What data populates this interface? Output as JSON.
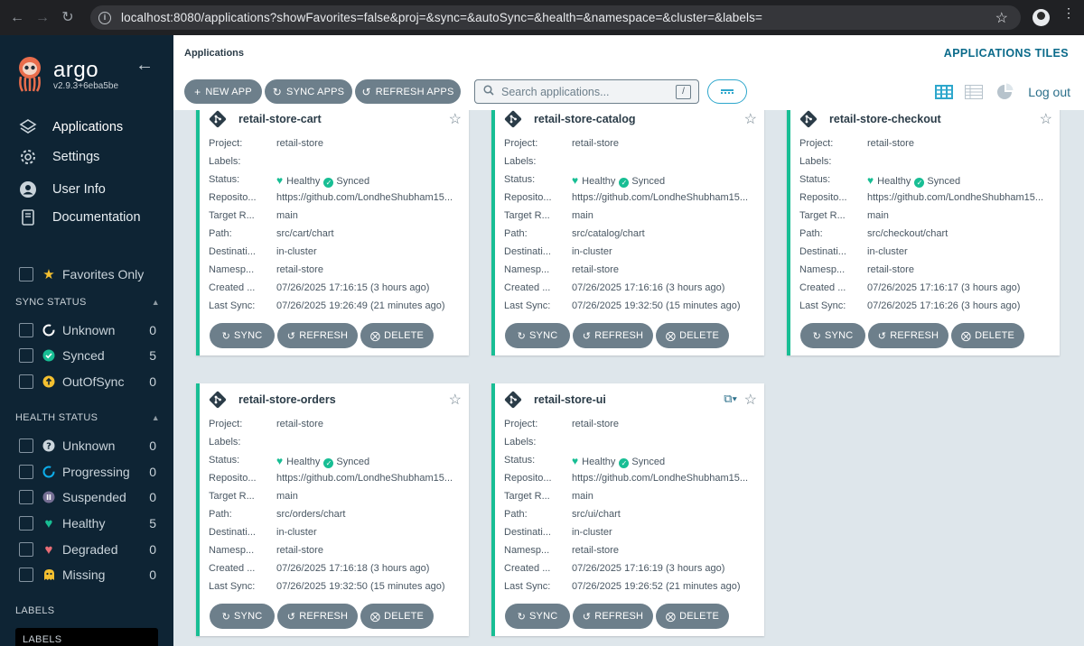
{
  "browser": {
    "url": "localhost:8080/applications?showFavorites=false&proj=&sync=&autoSync=&health=&namespace=&cluster=&labels="
  },
  "sidebar": {
    "brand": "argo",
    "version": "v2.9.3+6eba5be",
    "nav": [
      {
        "label": "Applications",
        "icon": "layers-icon"
      },
      {
        "label": "Settings",
        "icon": "gear-icon"
      },
      {
        "label": "User Info",
        "icon": "user-icon"
      },
      {
        "label": "Documentation",
        "icon": "book-icon"
      }
    ],
    "favorites_label": "Favorites Only",
    "sync_status": {
      "title": "SYNC STATUS",
      "items": [
        {
          "label": "Unknown",
          "count": "0",
          "icon": "circle-notch-icon",
          "color": "#ffffff"
        },
        {
          "label": "Synced",
          "count": "5",
          "icon": "check-circle-icon",
          "color": "#18be94"
        },
        {
          "label": "OutOfSync",
          "count": "0",
          "icon": "arrow-up-circle-icon",
          "color": "#f4c030"
        }
      ]
    },
    "health_status": {
      "title": "HEALTH STATUS",
      "items": [
        {
          "label": "Unknown",
          "count": "0",
          "icon": "question-circle-icon",
          "color": "#ccd6dd"
        },
        {
          "label": "Progressing",
          "count": "0",
          "icon": "circle-notch-icon",
          "color": "#0dadea"
        },
        {
          "label": "Suspended",
          "count": "0",
          "icon": "pause-circle-icon",
          "color": "#766f94"
        },
        {
          "label": "Healthy",
          "count": "5",
          "icon": "heart-icon",
          "color": "#18be94"
        },
        {
          "label": "Degraded",
          "count": "0",
          "icon": "heart-broken-icon",
          "color": "#e96d76"
        },
        {
          "label": "Missing",
          "count": "0",
          "icon": "ghost-icon",
          "color": "#f4c030"
        }
      ]
    },
    "labels": {
      "title": "LABELS",
      "placeholder": "LABELS"
    }
  },
  "header": {
    "breadcrumb": "Applications",
    "view_title": "APPLICATIONS TILES",
    "buttons": {
      "new_app": "NEW APP",
      "sync_apps": "SYNC APPS",
      "refresh_apps": "REFRESH APPS"
    },
    "search_placeholder": "Search applications...",
    "search_shortcut": "/",
    "logout": "Log out"
  },
  "card_labels": {
    "project": "Project:",
    "labels": "Labels:",
    "status": "Status:",
    "repository": "Reposito...",
    "target": "Target R...",
    "path": "Path:",
    "destination": "Destinati...",
    "namespace": "Namesp...",
    "created": "Created ...",
    "last_sync": "Last Sync:",
    "healthy": "Healthy",
    "synced": "Synced",
    "sync_btn": "SYNC",
    "refresh_btn": "REFRESH",
    "delete_btn": "DELETE"
  },
  "apps": [
    {
      "name": "retail-store-cart",
      "project": "retail-store",
      "labels": "",
      "repo": "https://github.com/LondheShubham15...",
      "target": "main",
      "path": "src/cart/chart",
      "destination": "in-cluster",
      "namespace": "retail-store",
      "created": "07/26/2025 17:16:15  (3 hours ago)",
      "last_sync": "07/26/2025 19:26:49  (21 minutes ago)"
    },
    {
      "name": "retail-store-catalog",
      "project": "retail-store",
      "labels": "",
      "repo": "https://github.com/LondheShubham15...",
      "target": "main",
      "path": "src/catalog/chart",
      "destination": "in-cluster",
      "namespace": "retail-store",
      "created": "07/26/2025 17:16:16  (3 hours ago)",
      "last_sync": "07/26/2025 19:32:50  (15 minutes ago)"
    },
    {
      "name": "retail-store-checkout",
      "project": "retail-store",
      "labels": "",
      "repo": "https://github.com/LondheShubham15...",
      "target": "main",
      "path": "src/checkout/chart",
      "destination": "in-cluster",
      "namespace": "retail-store",
      "created": "07/26/2025 17:16:17  (3 hours ago)",
      "last_sync": "07/26/2025 17:16:26  (3 hours ago)"
    },
    {
      "name": "retail-store-orders",
      "project": "retail-store",
      "labels": "",
      "repo": "https://github.com/LondheShubham15...",
      "target": "main",
      "path": "src/orders/chart",
      "destination": "in-cluster",
      "namespace": "retail-store",
      "created": "07/26/2025 17:16:18  (3 hours ago)",
      "last_sync": "07/26/2025 19:32:50  (15 minutes ago)"
    },
    {
      "name": "retail-store-ui",
      "project": "retail-store",
      "labels": "",
      "repo": "https://github.com/LondheShubham15...",
      "target": "main",
      "path": "src/ui/chart",
      "destination": "in-cluster",
      "namespace": "retail-store",
      "created": "07/26/2025 17:16:19  (3 hours ago)",
      "last_sync": "07/26/2025 19:26:52  (21 minutes ago)",
      "external_link": true
    }
  ]
}
